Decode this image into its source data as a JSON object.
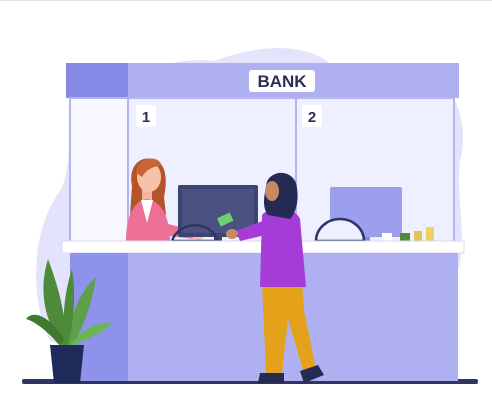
{
  "scene": {
    "sign_label": "BANK",
    "window_numbers": [
      "1",
      "2"
    ]
  },
  "colors": {
    "blob": "#e3e4fb",
    "counter_light": "#aeb0f2",
    "counter_mid": "#9c9fee",
    "counter_dark": "#8588e4",
    "glass": "#eef0ff",
    "floor": "#2f3563",
    "plant_leaf": "#4e8a3c",
    "pot": "#1f2a5a",
    "teller_shirt": "#ee6f96",
    "customer_shirt": "#a53cd8",
    "customer_pants": "#e3a21a",
    "hijab": "#262b54"
  }
}
